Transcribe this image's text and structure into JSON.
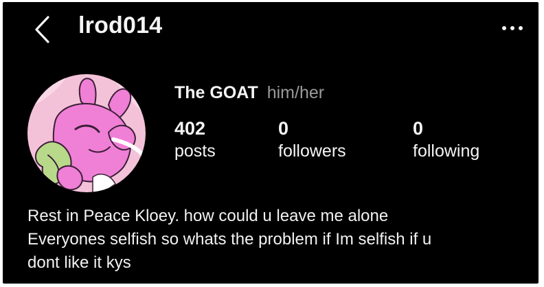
{
  "header": {
    "back_icon": "chevron-left-icon",
    "username": "lrod014",
    "more_icon": "more-horizontal-icon"
  },
  "profile": {
    "avatar_description_icon": "avatar-illustration",
    "display_name": "The GOAT",
    "pronouns": "him/her",
    "stats": {
      "posts": {
        "count": "402",
        "label": "posts"
      },
      "followers": {
        "count": "0",
        "label": "followers"
      },
      "following": {
        "count": "0",
        "label": "following"
      }
    },
    "bio": [
      "Rest in Peace Kloey. how could u leave me alone",
      "Everyones selfish so whats the problem if Im selfish if u",
      "dont like it kys"
    ]
  },
  "colors": {
    "background": "#000000",
    "text": "#f5f5f5",
    "muted": "#9a9a9a",
    "avatar_pink": "#f07fd6",
    "avatar_bg": "#f4c2d8",
    "avatar_green": "#b9d98a"
  }
}
